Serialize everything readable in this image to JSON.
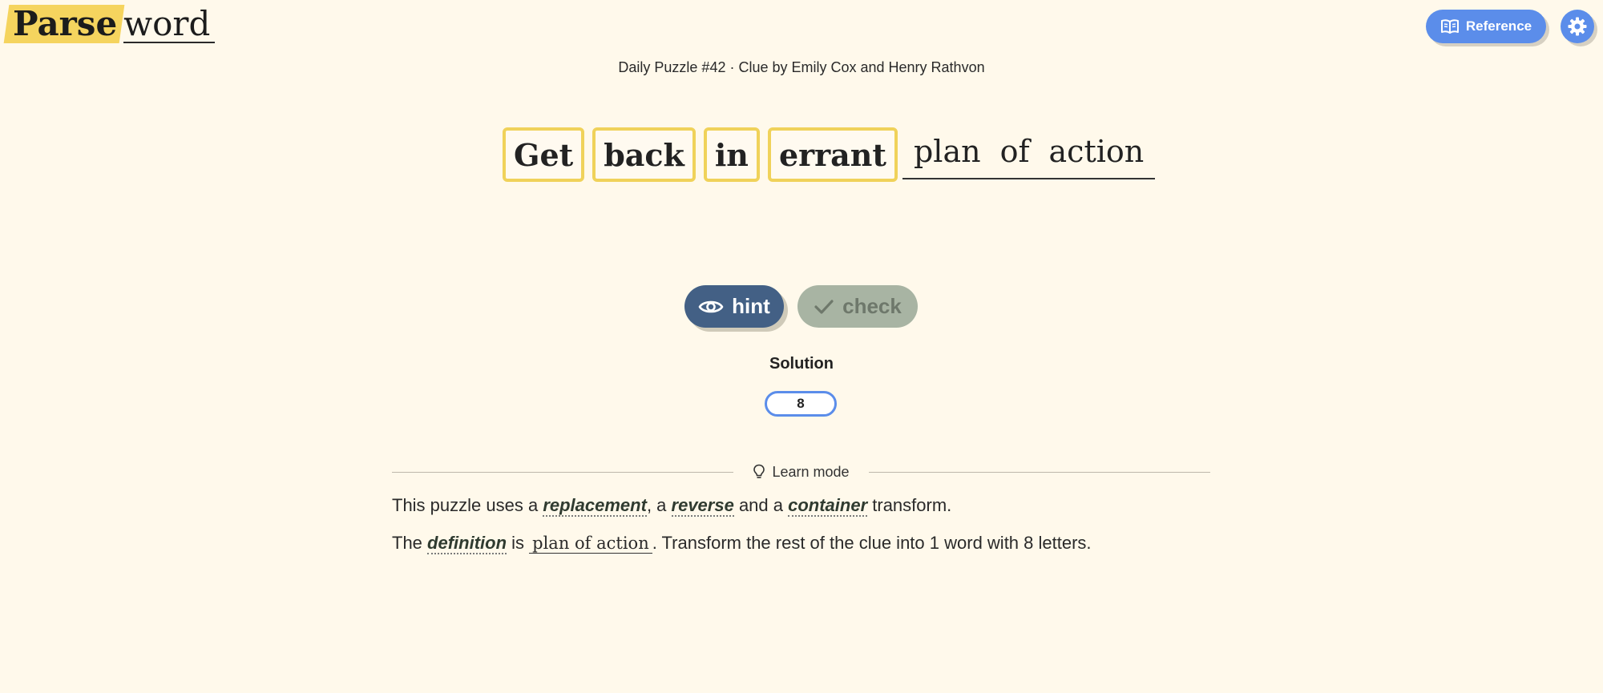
{
  "logo": {
    "part1": "Parse",
    "part2": "word"
  },
  "header": {
    "reference_label": "Reference"
  },
  "puzzle": {
    "subtitle": "Daily Puzzle #42 · Clue by Emily Cox and Henry Rathvon",
    "clue_words": [
      "Get",
      "back",
      "in",
      "errant"
    ],
    "definition_words": [
      "plan",
      "of",
      "action"
    ]
  },
  "actions": {
    "hint_label": "hint",
    "check_label": "check"
  },
  "solution": {
    "label": "Solution",
    "value": "8"
  },
  "learn": {
    "title": "Learn mode",
    "line1": {
      "t1": "This puzzle uses a ",
      "term1": "replacement",
      "t2": ", a ",
      "term2": "reverse",
      "t3": " and a ",
      "term3": "container",
      "t4": " transform."
    },
    "line2": {
      "t1": "The ",
      "term": "definition",
      "t2": " is ",
      "definition": "plan of action",
      "t3": ". Transform the rest of the clue into 1 word with 8 letters."
    }
  },
  "colors": {
    "background": "#fff9eb",
    "accent_blue": "#5b8dea",
    "logo_highlight": "#f5d45e",
    "word_border": "#f0d25a",
    "hint_button": "#436085",
    "check_button": "#a8b4a3"
  },
  "icons": {
    "reference": "book-open-icon",
    "settings": "gear-icon",
    "hint": "eye-icon",
    "check": "checkmark-icon",
    "learn": "lightbulb-icon"
  }
}
